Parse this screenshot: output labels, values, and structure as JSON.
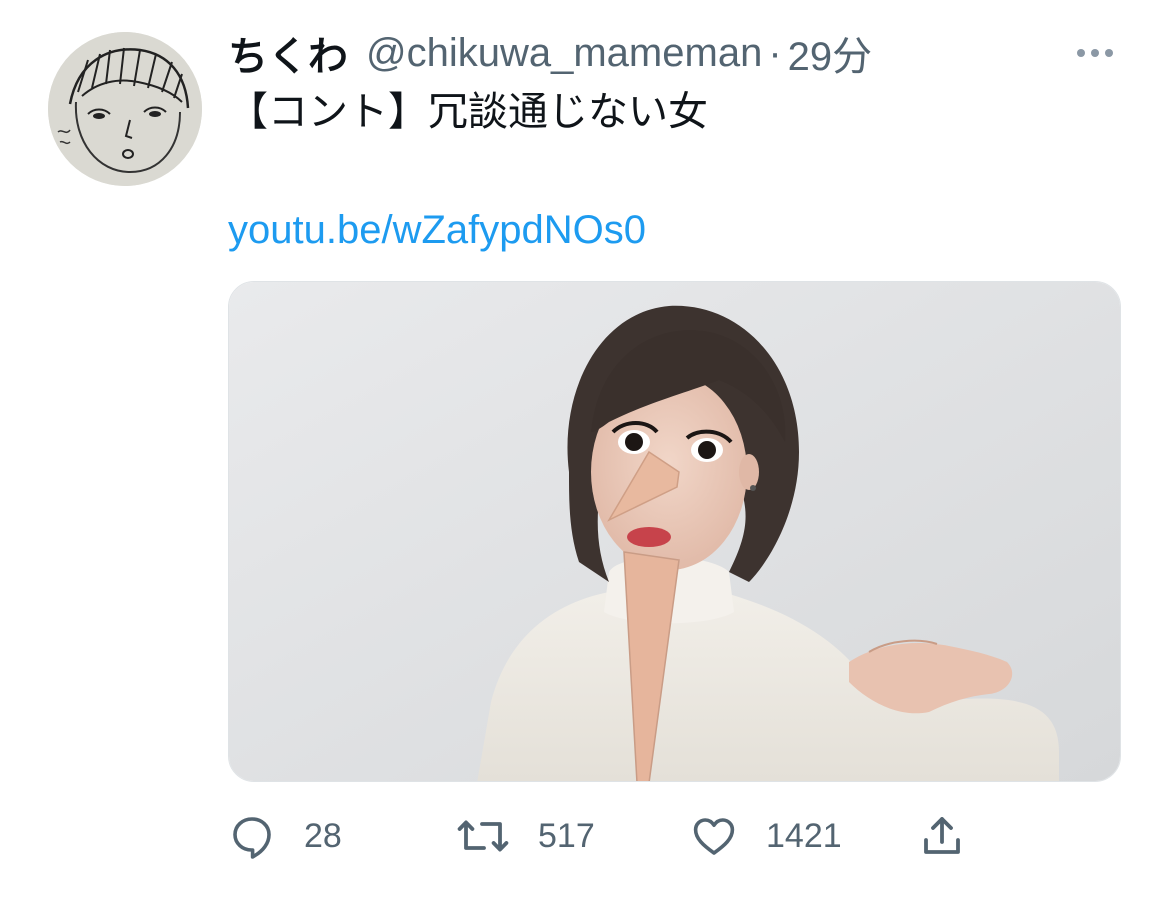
{
  "tweet": {
    "display_name": "ちくわ",
    "handle": "@chikuwa_mameman",
    "separator": "·",
    "time": "29分",
    "text": "【コント】冗談通じない女",
    "link": "youtu.be/wZafypdNOs0"
  },
  "actions": {
    "reply_count": "28",
    "retweet_count": "517",
    "like_count": "1421"
  },
  "icons": {
    "reply": "reply-icon",
    "retweet": "retweet-icon",
    "like": "heart-icon",
    "share": "share-icon",
    "more": "more-horizontal-icon"
  },
  "colors": {
    "link": "#1d9bf0",
    "secondary_text": "#536471",
    "primary_text": "#0f1419"
  }
}
